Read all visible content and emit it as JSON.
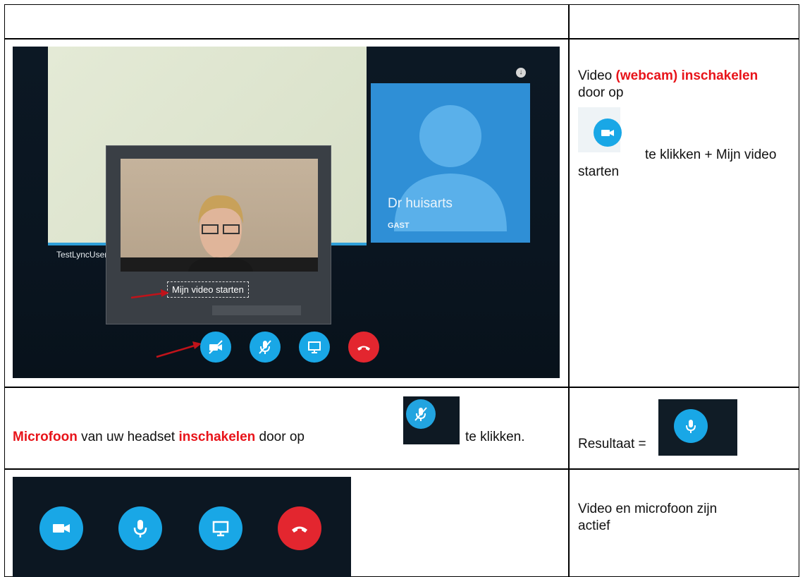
{
  "row1": {
    "instruction_part1": "Video ",
    "instruction_red1": "(webcam) inschakelen",
    "instruction_part2": " door op",
    "instruction_part3": "te klikken + Mijn video starten"
  },
  "shot": {
    "user_label": "TestLyncUser",
    "contact_name": "Dr huisarts",
    "contact_role": "GAST",
    "tooltip": "Mijn video starten"
  },
  "row2": {
    "red_word1": "Microfoon",
    "text1": " van uw headset ",
    "red_word2": "inschakelen",
    "text2": " door op",
    "text3": "te klikken.",
    "result_label": "Resultaat ="
  },
  "row3": {
    "status_text": "Video en microfoon zijn actief"
  },
  "icons": [
    "video-camera-icon",
    "microphone-icon",
    "screen-share-icon",
    "hang-up-icon",
    "download-icon",
    "person-silhouette-icon"
  ],
  "colors": {
    "accent_red": "#e8141a",
    "skype_blue": "#19a7e6",
    "hangup_red": "#e3262f"
  }
}
